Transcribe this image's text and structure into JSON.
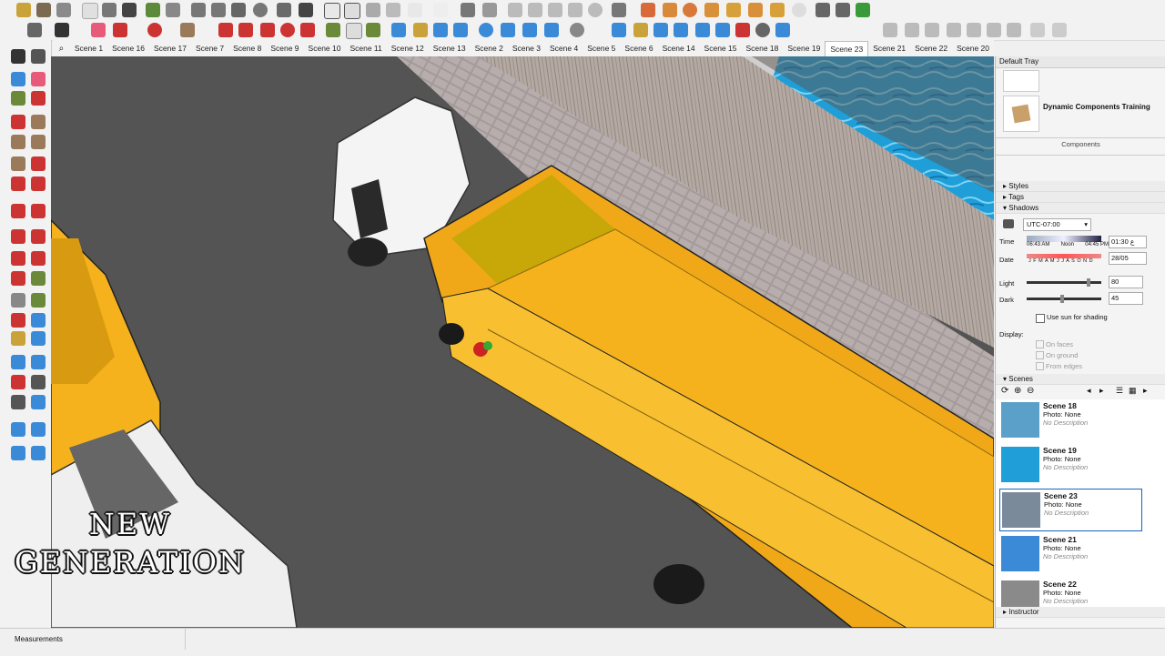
{
  "scene_tabs": [
    "Scene 1",
    "Scene 16",
    "Scene 17",
    "Scene 7",
    "Scene 8",
    "Scene 9",
    "Scene 10",
    "Scene 11",
    "Scene 12",
    "Scene 13",
    "Scene 2",
    "Scene 3",
    "Scene 4",
    "Scene 5",
    "Scene 6",
    "Scene 14",
    "Scene 15",
    "Scene 18",
    "Scene 19",
    "Scene 23",
    "Scene 21",
    "Scene 22",
    "Scene 20"
  ],
  "active_scene": "Scene 23",
  "tray": {
    "title": "Default Tray",
    "component_item": "Dynamic Components Training",
    "components_label": "Components",
    "styles_label": "Styles",
    "tags_label": "Tags",
    "shadows_label": "Shadows",
    "timezone": "UTC-07:00",
    "time_label": "Time",
    "time_start": "06:43 AM",
    "time_noon": "Noon",
    "time_end": "04:45 PM",
    "time_value": "01:30 ع",
    "date_label": "Date",
    "months": "J F M A M J J A S O N D",
    "date_value": "28/05",
    "light_label": "Light",
    "light_value": "80",
    "dark_label": "Dark",
    "dark_value": "45",
    "use_sun": "Use sun for shading",
    "display_label": "Display:",
    "on_faces": "On faces",
    "on_ground": "On ground",
    "from_edges": "From edges",
    "scenes_label": "Scenes",
    "instructor_label": "Instructor"
  },
  "scene_cards": [
    {
      "name": "Scene 18",
      "photo": "Photo: None",
      "desc": "No Description"
    },
    {
      "name": "Scene 19",
      "photo": "Photo: None",
      "desc": "No Description"
    },
    {
      "name": "Scene 23",
      "photo": "Photo: None",
      "desc": "No Description"
    },
    {
      "name": "Scene 21",
      "photo": "Photo: None",
      "desc": "No Description"
    },
    {
      "name": "Scene 22",
      "photo": "Photo: None",
      "desc": "No Description"
    }
  ],
  "status": {
    "measurements_label": "Measurements"
  },
  "overlay": {
    "line1": "NEW",
    "line2": "GENERATION"
  },
  "colors": {
    "truck_yellow": "#f5b21c",
    "pool_blue": "#1f9ed8",
    "road": "#545454",
    "selection": "#1565c0"
  }
}
